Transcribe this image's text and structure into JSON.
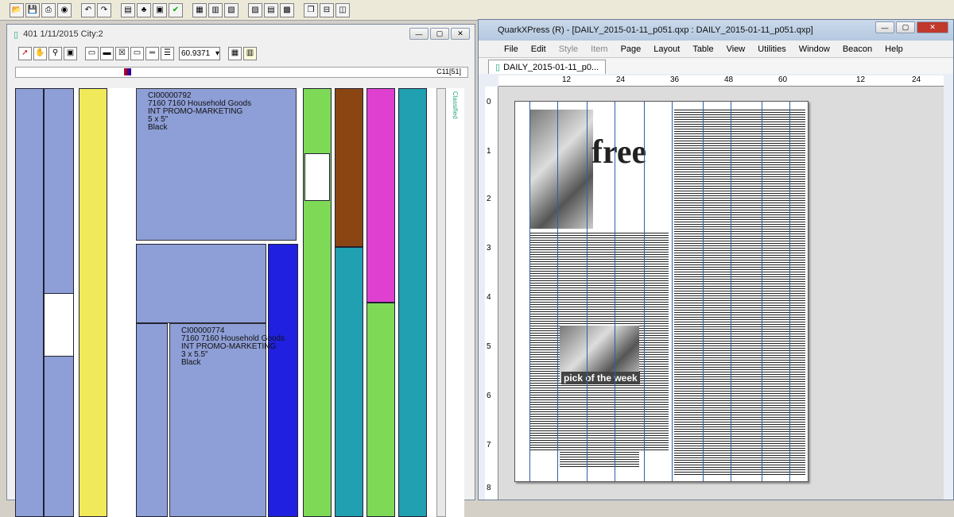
{
  "main_toolbar": {
    "buttons": [
      "open",
      "save",
      "print",
      "color",
      "undo",
      "redo",
      "doc",
      "tree",
      "check",
      "check",
      "layout",
      "layout",
      "layout",
      "doc",
      "doc",
      "doc",
      "win",
      "win",
      "win"
    ]
  },
  "left_window": {
    "title": "401 1/11/2015 City:2",
    "zoom": "60.9371",
    "column_header_label": "C11[51]",
    "side_label": "Classified",
    "ads": [
      {
        "id": "CI00000792",
        "line1": "7160 7160 Household Goods",
        "line2": "INT PROMO-MARKETING",
        "size": "5 x 5\"",
        "color": "Black"
      },
      {
        "id": "CI00000774",
        "line1": "7160 7160 Household Goods",
        "line2": "INT PROMO-MARKETING",
        "size": "3 x 5.5\"",
        "color": "Black"
      }
    ]
  },
  "right_window": {
    "title": "QuarkXPress (R) - [DAILY_2015-01-11_p051.qxp : DAILY_2015-01-11_p051.qxp]",
    "menu": [
      "File",
      "Edit",
      "Style",
      "Item",
      "Page",
      "Layout",
      "Table",
      "View",
      "Utilities",
      "Window",
      "Beacon",
      "Help"
    ],
    "tab_label": "DAILY_2015-01-11_p0...",
    "ruler_h": [
      "12",
      "24",
      "36",
      "48",
      "60",
      "12",
      "24"
    ],
    "ruler_v": [
      "0",
      "1",
      "2",
      "3",
      "4",
      "5",
      "6",
      "7",
      "8"
    ],
    "page_headline": "free",
    "feature_label": "pick of the week"
  },
  "colors": {
    "ad_blue": "#8e9ed6",
    "yellow": "#f0ea5a",
    "green": "#7ed957",
    "brown": "#8b4513",
    "magenta": "#e040d0",
    "teal": "#20a0b0",
    "purple_blue": "#2020e0",
    "guide_blue": "#2e5fa8"
  }
}
